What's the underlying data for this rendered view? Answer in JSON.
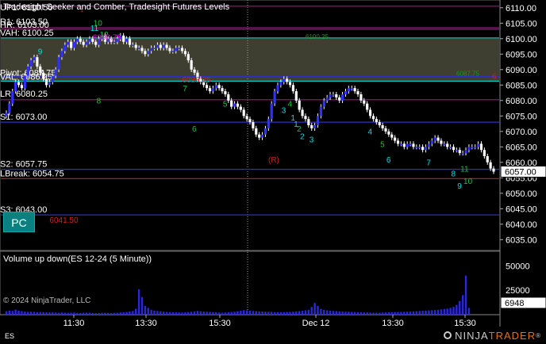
{
  "indicator_title": "Tradesight Seeker and Comber, Tradesight Futures Levels",
  "levels": [
    {
      "id": "up1",
      "label": "UP1: 6110.50",
      "price": 6110.5,
      "color": "#9a1b7a",
      "dash": false,
      "shade": false,
      "labelled": true
    },
    {
      "id": "r1",
      "label": "R1: 6103.50",
      "price": 6103.5,
      "color": "#9a1b7a",
      "dash": false,
      "shade": false,
      "labelled": true
    },
    {
      "id": "hr",
      "label": "HR: 6103.00",
      "price": 6103.0,
      "color": "#9a1b7a",
      "dash": false,
      "shade": false,
      "labelled": true
    },
    {
      "id": "vah",
      "label": "VAH: 6100.25",
      "price": 6100.25,
      "color": "#00c8c8",
      "dash": false,
      "shade": false,
      "labelled": true
    },
    {
      "id": "pivot",
      "label": "Pivot: 6087.75",
      "price": 6087.75,
      "color": "#3030c0",
      "dash": false,
      "shade": false,
      "labelled": true
    },
    {
      "id": "val",
      "label": "VAL: 6086.25",
      "price": 6086.25,
      "color": "#00c8c8",
      "dash": false,
      "shade": false,
      "labelled": true
    },
    {
      "id": "lr",
      "label": "LR: 6080.25",
      "price": 6080.25,
      "color": "#9a1b7a",
      "dash": false,
      "shade": false,
      "labelled": true
    },
    {
      "id": "s1",
      "label": "S1: 6073.00",
      "price": 6073.0,
      "color": "#3030c0",
      "dash": false,
      "shade": false,
      "labelled": true
    },
    {
      "id": "s2",
      "label": "S2: 6057.75",
      "price": 6057.75,
      "color": "#3030c0",
      "dash": false,
      "shade": false,
      "labelled": true
    },
    {
      "id": "lbreak",
      "label": "LBreak: 6054.75",
      "price": 6054.75,
      "color": "#c02020",
      "dash": false,
      "shade": false,
      "labelled": true
    },
    {
      "id": "s3",
      "label": "S3: 6043.00",
      "price": 6043.0,
      "color": "#3030c0",
      "dash": false,
      "shade": false,
      "labelled": true
    }
  ],
  "value_area": {
    "high": 6100.25,
    "low": 6086.25,
    "color": "#4a4a3a"
  },
  "price_axis": {
    "min": 6031.5,
    "max": 6112.5,
    "ticks": [
      6110,
      6105,
      6100,
      6095,
      6090,
      6085,
      6080,
      6075,
      6070,
      6065,
      6060,
      6055,
      6050,
      6045,
      6040,
      6035
    ],
    "last_price": "6057.00"
  },
  "volume_panel": {
    "title": "Volume up down(ES 12-24 (5 Minute))",
    "ticks": [
      "50000",
      "25000"
    ],
    "last_value": "6948",
    "copyright": "© 2024 NinjaTrader, LLC",
    "ymax": 60000
  },
  "time_axis": {
    "labels": [
      "11:30",
      "13:30",
      "15:30",
      "Dec 12",
      "13:30",
      "15:30"
    ],
    "exchange": "ES"
  },
  "markers": {
    "arrow_label": "↓",
    "boxes": [
      {
        "text": "6098.75",
        "price": 6100.6,
        "bar": 28,
        "color": "#d020d0"
      },
      {
        "text": "6086.25",
        "price": 6086.9,
        "bar": 57,
        "color": "#d02020"
      },
      {
        "text": "6041.50",
        "price": 6041.5,
        "bar": 14,
        "color": "#d02020"
      }
    ],
    "r_marker": {
      "text": "(R)",
      "color": "#d02020"
    },
    "faded_texts": [
      "6100.25",
      "6087.75"
    ]
  },
  "seq_counts": [
    "12",
    "10",
    "11",
    "9",
    "8",
    "7",
    "6",
    "5",
    "4",
    "3",
    "2",
    "1",
    "1",
    "2",
    "3",
    "4",
    "5",
    "6",
    "7",
    "8",
    "9",
    "10",
    "11"
  ],
  "pc_button": "PC",
  "brand": {
    "name": "NINJA",
    "tail": "TRADER",
    "mark": "®"
  },
  "chart_data": {
    "type": "candlestick",
    "title": "Tradesight Seeker and Comber, Tradesight Futures Levels",
    "instrument": "ES 12-24 (5 Minute)",
    "ylim": [
      6031.5,
      6112.5
    ],
    "closes": [
      6076,
      6079,
      6083,
      6086,
      6085,
      6084,
      6088,
      6091,
      6093,
      6094,
      6091,
      6089,
      6087,
      6085,
      6086,
      6088,
      6090,
      6094,
      6096,
      6098,
      6099,
      6097,
      6099,
      6100,
      6099,
      6098,
      6099,
      6100,
      6099,
      6098,
      6100,
      6101,
      6099,
      6100,
      6099,
      6099,
      6100,
      6101,
      6099,
      6100,
      6098,
      6098,
      6097,
      6097,
      6096,
      6095,
      6096,
      6097,
      6097,
      6098,
      6097,
      6098,
      6097,
      6096,
      6096,
      6097,
      6097,
      6096,
      6095,
      6093,
      6090,
      6089,
      6087,
      6086,
      6085,
      6084,
      6083,
      6084,
      6085,
      6084,
      6083,
      6082,
      6080,
      6078,
      6079,
      6078,
      6077,
      6075,
      6074,
      6073,
      6071,
      6069,
      6068,
      6069,
      6071,
      6074,
      6079,
      6083,
      6085,
      6086,
      6087,
      6086,
      6085,
      6083,
      6080,
      6077,
      6075,
      6074,
      6072,
      6071,
      6072,
      6075,
      6078,
      6080,
      6081,
      6082,
      6082,
      6081,
      6080,
      6082,
      6083,
      6084,
      6084,
      6083,
      6082,
      6080,
      6079,
      6077,
      6075,
      6074,
      6073,
      6072,
      6071,
      6070,
      6069,
      6068,
      6067,
      6066,
      6066,
      6065,
      6066,
      6066,
      6065,
      6065,
      6065,
      6064,
      6065,
      6066,
      6067,
      6068,
      6067,
      6066,
      6066,
      6065,
      6065,
      6064,
      6064,
      6063,
      6063,
      6064,
      6065,
      6065,
      6065,
      6066,
      6064,
      6062,
      6060,
      6058,
      6057
    ],
    "volumes": [
      3500,
      4200,
      3800,
      5200,
      4100,
      3600,
      3200,
      2800,
      3000,
      2900,
      2500,
      2700,
      2600,
      2400,
      2300,
      2500,
      2200,
      2000,
      2300,
      2100,
      1900,
      2000,
      2200,
      1800,
      1700,
      1900,
      2100,
      2000,
      1800,
      1600,
      1700,
      1900,
      2000,
      1800,
      1700,
      1900,
      2000,
      2200,
      2500,
      2800,
      3200,
      3800,
      6000,
      26000,
      18000,
      9000,
      7000,
      5000,
      4200,
      3800,
      3500,
      3000,
      2800,
      2600,
      2500,
      2400,
      2300,
      2200,
      2400,
      2600,
      3000,
      3400,
      3800,
      3500,
      3200,
      3000,
      2800,
      2600,
      2400,
      2200,
      2000,
      2300,
      2500,
      2800,
      3000,
      3500,
      4000,
      4600,
      4500,
      4200,
      3800,
      3600,
      3400,
      3200,
      3000,
      2900,
      2800,
      2700,
      2600,
      2500,
      2600,
      2700,
      2800,
      3000,
      3300,
      3600,
      4000,
      4500,
      5000,
      8000,
      12000,
      9000,
      6000,
      5000,
      4500,
      4000,
      3800,
      3600,
      3400,
      3200,
      3000,
      2900,
      2800,
      2700,
      2600,
      2500,
      2400,
      2300,
      2200,
      2100,
      2000,
      2100,
      2200,
      2300,
      2400,
      2500,
      2600,
      2700,
      2800,
      2900,
      3000,
      3200,
      3400,
      3600,
      3800,
      4000,
      4200,
      4400,
      4600,
      4800,
      5000,
      5400,
      5800,
      6200,
      7000,
      8000,
      10000,
      14000,
      20000,
      40000,
      6948
    ]
  }
}
